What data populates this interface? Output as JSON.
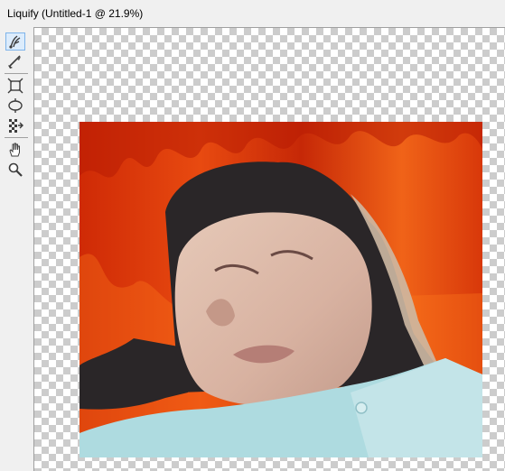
{
  "window": {
    "title": "Liquify (Untitled-1 @ 21.9%)"
  },
  "tools": [
    {
      "name": "forward-warp-tool-icon",
      "active": true
    },
    {
      "name": "reconstruct-tool-icon",
      "active": false
    },
    {
      "name": "pucker-tool-icon",
      "active": false
    },
    {
      "name": "bloat-tool-icon",
      "active": false
    },
    {
      "name": "push-left-tool-icon",
      "active": false
    },
    {
      "name": "hand-tool-icon",
      "active": false
    },
    {
      "name": "zoom-tool-icon",
      "active": false
    }
  ],
  "colors": {
    "fire_dark": "#b31a05",
    "fire_mid": "#e6400f",
    "fire_light": "#ff8a1e",
    "shirt": "#aedbe0",
    "hair": "#2a2628",
    "skin": "#d9b7a6"
  }
}
